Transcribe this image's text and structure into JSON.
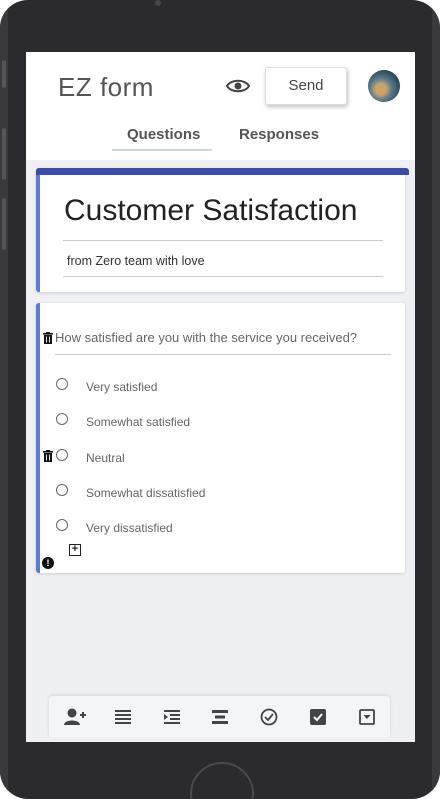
{
  "app": {
    "logo": "EZ form",
    "send_label": "Send"
  },
  "tabs": [
    {
      "label": "Questions",
      "active": true
    },
    {
      "label": "Responses",
      "active": false
    }
  ],
  "form": {
    "title": "Customer Satisfaction",
    "description": "from Zero team with love"
  },
  "question": {
    "text": "How satisfied are you with the service you received?",
    "options": [
      {
        "label": "Very satisfied"
      },
      {
        "label": "Somewhat satisfied"
      },
      {
        "label": "Neutral"
      },
      {
        "label": "Somewhat dissatisfied"
      },
      {
        "label": "Very dissatisfied"
      }
    ]
  },
  "toolbar": {
    "items": [
      "add-user-icon",
      "paragraph-icon",
      "indent-icon",
      "short-text-icon",
      "check-circle-icon",
      "checkbox-icon",
      "dropdown-icon"
    ]
  },
  "colors": {
    "accent": "#3b4da8",
    "card_border": "#5b7bd5",
    "background": "#eef0f4"
  }
}
